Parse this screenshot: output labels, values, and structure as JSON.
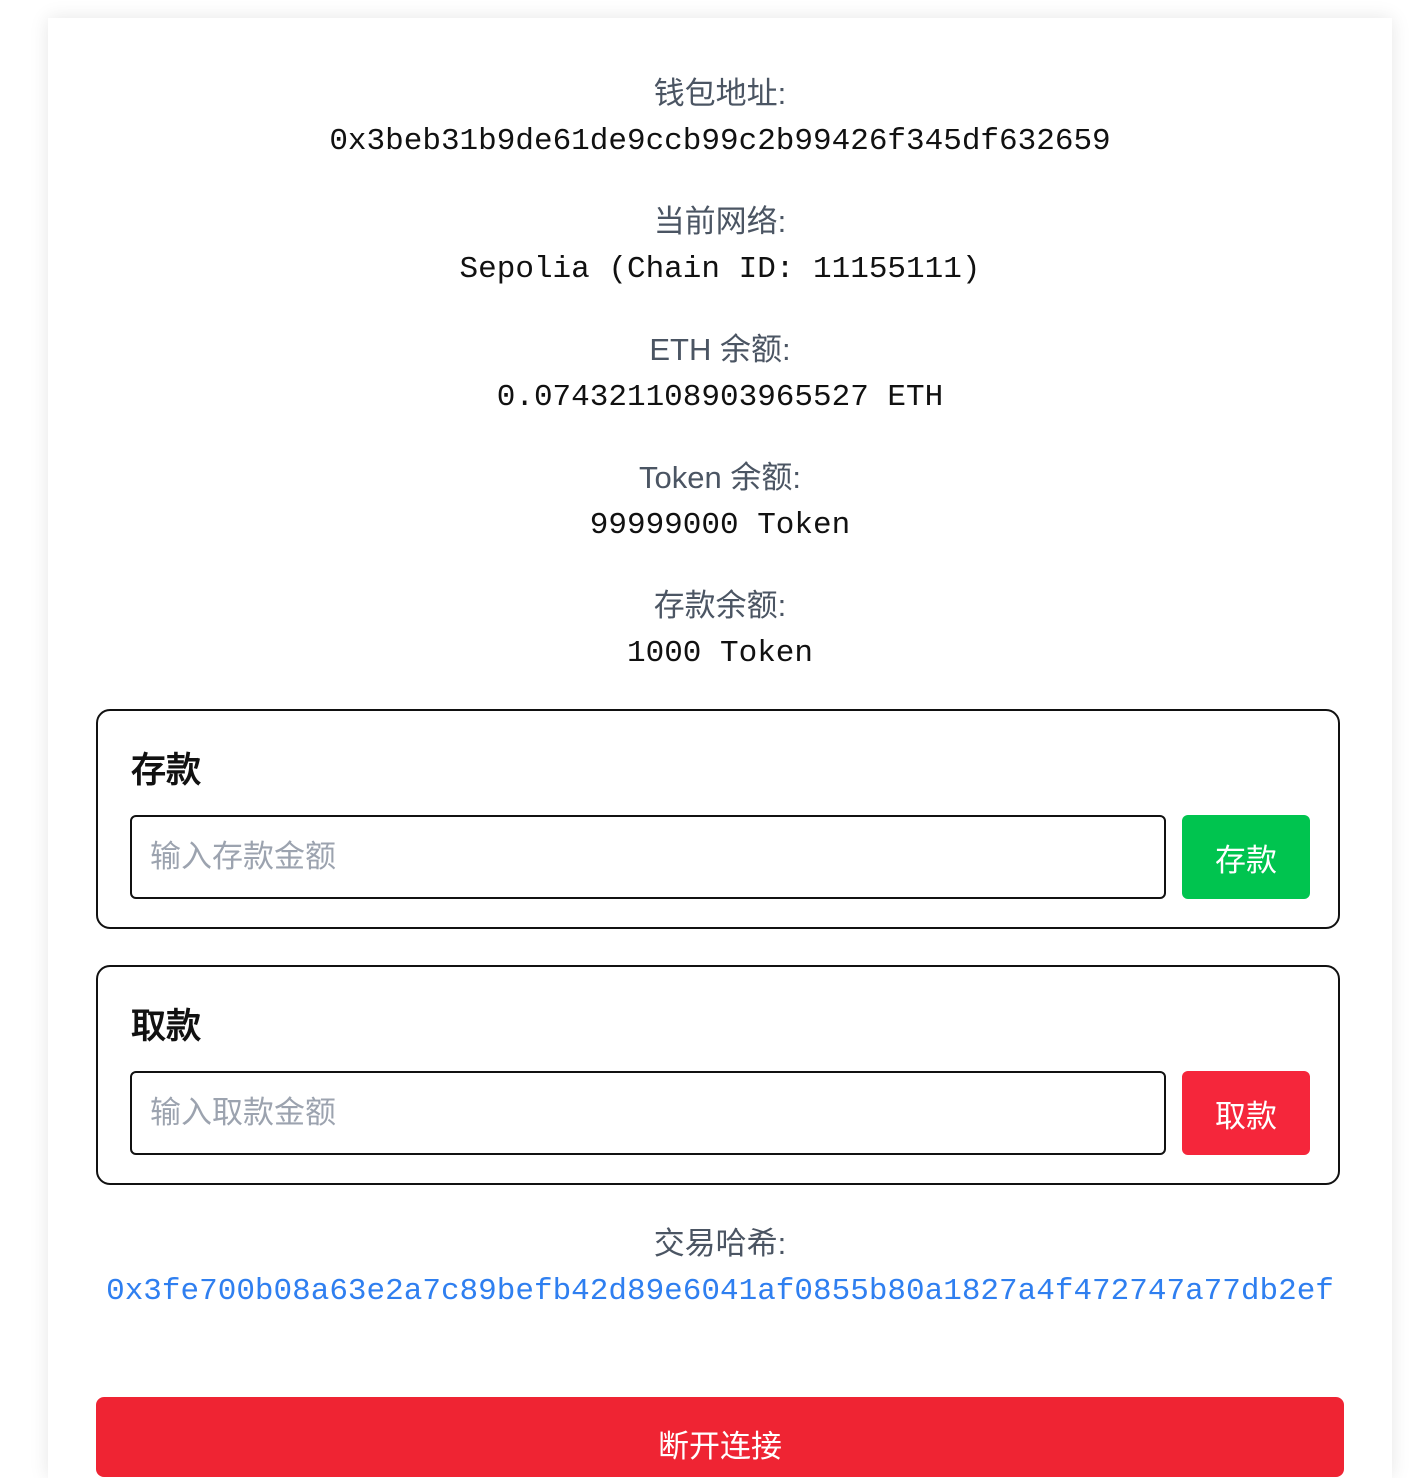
{
  "account": {
    "address_label": "钱包地址:",
    "address_value": "0x3beb31b9de61de9ccb99c2b99426f345df632659",
    "network_label": "当前网络:",
    "network_value": "Sepolia (Chain ID: 11155111)",
    "eth_label": "ETH 余额:",
    "eth_value": "0.074321108903965527 ETH",
    "token_label": "Token 余额:",
    "token_value": "99999000 Token",
    "deposit_balance_label": "存款余额:",
    "deposit_balance_value": "1000 Token"
  },
  "deposit": {
    "title": "存款",
    "placeholder": "输入存款金额",
    "button_label": "存款"
  },
  "withdraw": {
    "title": "取款",
    "placeholder": "输入取款金额",
    "button_label": "取款"
  },
  "transaction": {
    "label": "交易哈希:",
    "hash": "0x3fe700b08a63e2a7c89befb42d89e6041af0855b80a1827a4f472747a77db2ef"
  },
  "disconnect": {
    "label": "断开连接"
  },
  "colors": {
    "deposit_button": "#00c44f",
    "withdraw_button": "#f5263b",
    "disconnect_button": "#ef2433",
    "hash_link": "#2f7ff0"
  }
}
